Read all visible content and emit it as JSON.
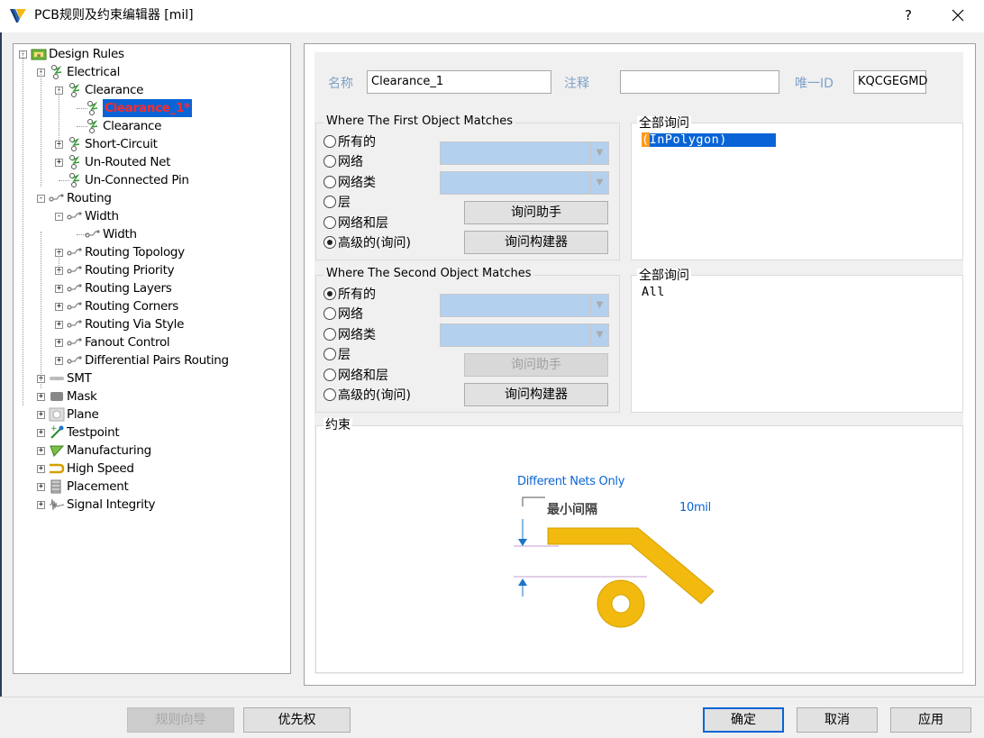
{
  "window": {
    "title": "PCB规则及约束编辑器 [mil]",
    "help": "?",
    "icon": "pcb-rules-icon"
  },
  "tree": [
    {
      "label": "Design Rules",
      "icon": "design-rules-icon"
    },
    {
      "label": "Electrical",
      "icon": "electrical-icon"
    },
    {
      "label": "Clearance",
      "icon": "clearance-icon"
    },
    {
      "label": "Clearance_1*",
      "icon": "clearance-rule-icon",
      "selected": true
    },
    {
      "label": "Clearance",
      "icon": "clearance-rule-icon"
    },
    {
      "label": "Short-Circuit",
      "icon": "short-circuit-icon"
    },
    {
      "label": "Un-Routed Net",
      "icon": "unrouted-net-icon"
    },
    {
      "label": "Un-Connected Pin",
      "icon": "unconnected-pin-icon"
    },
    {
      "label": "Routing",
      "icon": "routing-icon"
    },
    {
      "label": "Width",
      "icon": "width-icon"
    },
    {
      "label": "Width",
      "icon": "width-rule-icon"
    },
    {
      "label": "Routing Topology",
      "icon": "routing-topology-icon"
    },
    {
      "label": "Routing Priority",
      "icon": "routing-priority-icon"
    },
    {
      "label": "Routing Layers",
      "icon": "routing-layers-icon"
    },
    {
      "label": "Routing Corners",
      "icon": "routing-corners-icon"
    },
    {
      "label": "Routing Via Style",
      "icon": "routing-via-style-icon"
    },
    {
      "label": "Fanout Control",
      "icon": "fanout-control-icon"
    },
    {
      "label": "Differential Pairs Routing",
      "icon": "diff-pairs-icon"
    },
    {
      "label": "SMT",
      "icon": "smt-icon"
    },
    {
      "label": "Mask",
      "icon": "mask-icon"
    },
    {
      "label": "Plane",
      "icon": "plane-icon"
    },
    {
      "label": "Testpoint",
      "icon": "testpoint-icon"
    },
    {
      "label": "Manufacturing",
      "icon": "manufacturing-icon"
    },
    {
      "label": "High Speed",
      "icon": "high-speed-icon"
    },
    {
      "label": "Placement",
      "icon": "placement-icon"
    },
    {
      "label": "Signal Integrity",
      "icon": "signal-integrity-icon"
    }
  ],
  "rule": {
    "name_label": "名称",
    "name_value": "Clearance_1",
    "comment_label": "注释",
    "comment_value": "",
    "uid_label": "唯一ID",
    "uid_value": "KQCGEGMD"
  },
  "first": {
    "title": "Where The First Object Matches",
    "options": [
      "所有的",
      "网络",
      "网络类",
      "层",
      "网络和层",
      "高级的(询问)"
    ],
    "selected": "高级的(询问)",
    "helper_button": "询问助手",
    "builder_button": "询问构建器",
    "query_title": "全部询问",
    "query_text": "(InPolygon)",
    "query_caret": "(",
    "query_rest": "InPolygon)"
  },
  "second": {
    "title": "Where The Second Object Matches",
    "options": [
      "所有的",
      "网络",
      "网络类",
      "层",
      "网络和层",
      "高级的(询问)"
    ],
    "selected": "所有的",
    "helper_button": "询问助手",
    "builder_button": "询问构建器",
    "query_title": "全部询问",
    "query_text": "All"
  },
  "constraint": {
    "title": "约束",
    "net_scope": "Different Nets Only",
    "min_clearance_label": "最小间隔",
    "min_clearance_value": "10mil",
    "colors": {
      "track": "#f2b90f",
      "track_edge": "#d4a000",
      "scope_text": "#0a64d6",
      "arrow": "#1a75c9",
      "guide": "#c79fd6"
    }
  },
  "footer": {
    "wizard": "规则向导",
    "priority": "优先权",
    "ok": "确定",
    "cancel": "取消",
    "apply": "应用"
  }
}
